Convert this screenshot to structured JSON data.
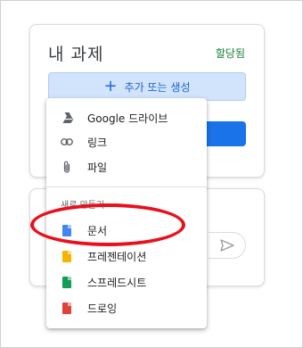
{
  "assignment": {
    "title": "내 과제",
    "status": "할당됨",
    "add_button_label": "추가 또는 생성"
  },
  "menu": {
    "items": [
      {
        "label": "Google 드라이브",
        "icon": "google-drive-icon"
      },
      {
        "label": "링크",
        "icon": "link-icon"
      },
      {
        "label": "파일",
        "icon": "attachment-icon"
      }
    ],
    "section_label": "새로 만들기",
    "create_items": [
      {
        "label": "문서",
        "icon": "google-docs-icon",
        "color": "#4285f4"
      },
      {
        "label": "프레젠테이션",
        "icon": "google-slides-icon",
        "color": "#f4b400"
      },
      {
        "label": "스프레드시트",
        "icon": "google-sheets-icon",
        "color": "#0f9d58"
      },
      {
        "label": "드로잉",
        "icon": "google-drawings-icon",
        "color": "#db4437"
      }
    ]
  },
  "colors": {
    "accent": "#1a73e8",
    "status_green": "#188038",
    "annotation_red": "#e8101c"
  }
}
